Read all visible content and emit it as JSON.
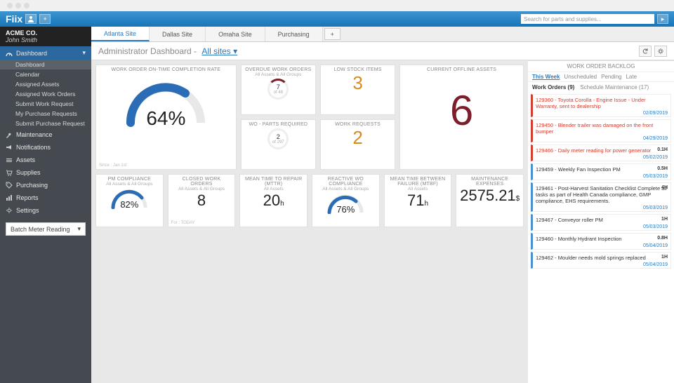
{
  "app": {
    "logo": "Fiix"
  },
  "search": {
    "placeholder": "Search for parts and supplies..."
  },
  "account": {
    "company": "ACME CO.",
    "user": "John Smith"
  },
  "nav": {
    "dashboard": "Dashboard",
    "subs": [
      "Dashboard",
      "Calendar",
      "Assigned Assets",
      "Assigned Work Orders",
      "Submit Work Request",
      "My Purchase Requests",
      "Submit Purchase Request"
    ],
    "items": [
      {
        "label": "Maintenance",
        "icon": "wrench"
      },
      {
        "label": "Notifications",
        "icon": "bullhorn"
      },
      {
        "label": "Assets",
        "icon": "stack"
      },
      {
        "label": "Supplies",
        "icon": "cart"
      },
      {
        "label": "Purchasing",
        "icon": "tag"
      },
      {
        "label": "Reports",
        "icon": "chart"
      },
      {
        "label": "Settings",
        "icon": "gear"
      }
    ],
    "batch": "Batch Meter Reading"
  },
  "tabs": [
    "Atlanta Site",
    "Dallas Site",
    "Omaha Site",
    "Purchasing"
  ],
  "header": {
    "title": "Administrator Dashboard -",
    "link": "All sites"
  },
  "cards": {
    "ontime": {
      "title": "WORK ORDER ON-TIME COMPLETION RATE",
      "pct": "64%",
      "since": "Since : Jan 1st"
    },
    "overdue": {
      "title": "OVERDUE WORK ORDERS",
      "sub": "All Assets & All Groups",
      "n": "7",
      "d": "of 48"
    },
    "lowstock": {
      "title": "LOW STOCK ITEMS",
      "val": "3"
    },
    "offline": {
      "title": "CURRENT OFFLINE ASSETS",
      "val": "6"
    },
    "wopart": {
      "title": "WO - PARTS REQUIRED",
      "n": "2",
      "d": "of 297"
    },
    "workreq": {
      "title": "WORK REQUESTS",
      "val": "2"
    },
    "pm": {
      "title": "PM COMPLIANCE",
      "sub": "All Assets & All Groups",
      "pct": "82%"
    },
    "closed": {
      "title": "CLOSED WORK ORDERS",
      "sub": "All Assets & All Groups",
      "val": "8",
      "since": "For : TODAY"
    },
    "mttr": {
      "title": "MEAN TIME TO REPAIR (MTTR)",
      "sub": "All Assets",
      "val": "20",
      "unit": "h"
    },
    "reactive": {
      "title": "REACTIVE WO COMPLIANCE",
      "sub": "All Assets & All Groups",
      "pct": "76%"
    },
    "mtbf": {
      "title": "MEAN TIME BETWEEN FAILURE (MTBF)",
      "sub": "All Assets",
      "val": "71",
      "unit": "h"
    },
    "expenses": {
      "title": "MAINTENANCE EXPENSES",
      "val": "2575.21",
      "unit": "$"
    }
  },
  "backlog": {
    "title": "WORK ORDER BACKLOG",
    "tabs": [
      "This Week",
      "Unscheduled",
      "Pending",
      "Late"
    ],
    "sub": {
      "wo": "Work Orders (9)",
      "sm": "Schedule Maintenance (17)"
    },
    "items": [
      {
        "c": "red",
        "t": "129360 - Toyota Corolla - Engine Issue - Under Warranty, sent to dealership",
        "date": "02/09/2019",
        "hr": ""
      },
      {
        "c": "red",
        "t": "129450 - Blender trailer was damaged on the front bumper",
        "date": "04/29/2019",
        "hr": ""
      },
      {
        "c": "red",
        "t": "129466 - Daily meter reading for power generator",
        "date": "05/02/2019",
        "hr": "0.1H"
      },
      {
        "c": "blue",
        "t": "129459 - Weekly Fan Inspection PM",
        "date": "05/03/2019",
        "hr": "0.5H"
      },
      {
        "c": "blue",
        "t": "129461 - Post-Harvest Sanitation Checklist Complete all tasks as part of Health Canada compliance, GMP compliance, EHS requirements.",
        "date": "05/03/2019",
        "hr": "4H"
      },
      {
        "c": "blue",
        "t": "129467 - Conveyor roller PM",
        "date": "05/03/2019",
        "hr": "1H"
      },
      {
        "c": "blue",
        "t": "129460 - Monthly Hydrant Inspection",
        "date": "05/04/2019",
        "hr": "0.8H"
      },
      {
        "c": "blue",
        "t": "129462 - Moulder needs mold springs replaced",
        "date": "05/04/2019",
        "hr": "1H"
      }
    ]
  },
  "chart_data": [
    {
      "type": "gauge",
      "name": "ontime",
      "value": 64,
      "max": 100,
      "title": "WORK ORDER ON-TIME COMPLETION RATE"
    },
    {
      "type": "gauge",
      "name": "pm",
      "value": 82,
      "max": 100,
      "title": "PM COMPLIANCE"
    },
    {
      "type": "gauge",
      "name": "reactive",
      "value": 76,
      "max": 100,
      "title": "REACTIVE WO COMPLIANCE"
    },
    {
      "type": "donut",
      "name": "overdue",
      "value": 7,
      "total": 48,
      "title": "OVERDUE WORK ORDERS"
    },
    {
      "type": "donut",
      "name": "wopart",
      "value": 2,
      "total": 297,
      "title": "WO - PARTS REQUIRED"
    }
  ]
}
